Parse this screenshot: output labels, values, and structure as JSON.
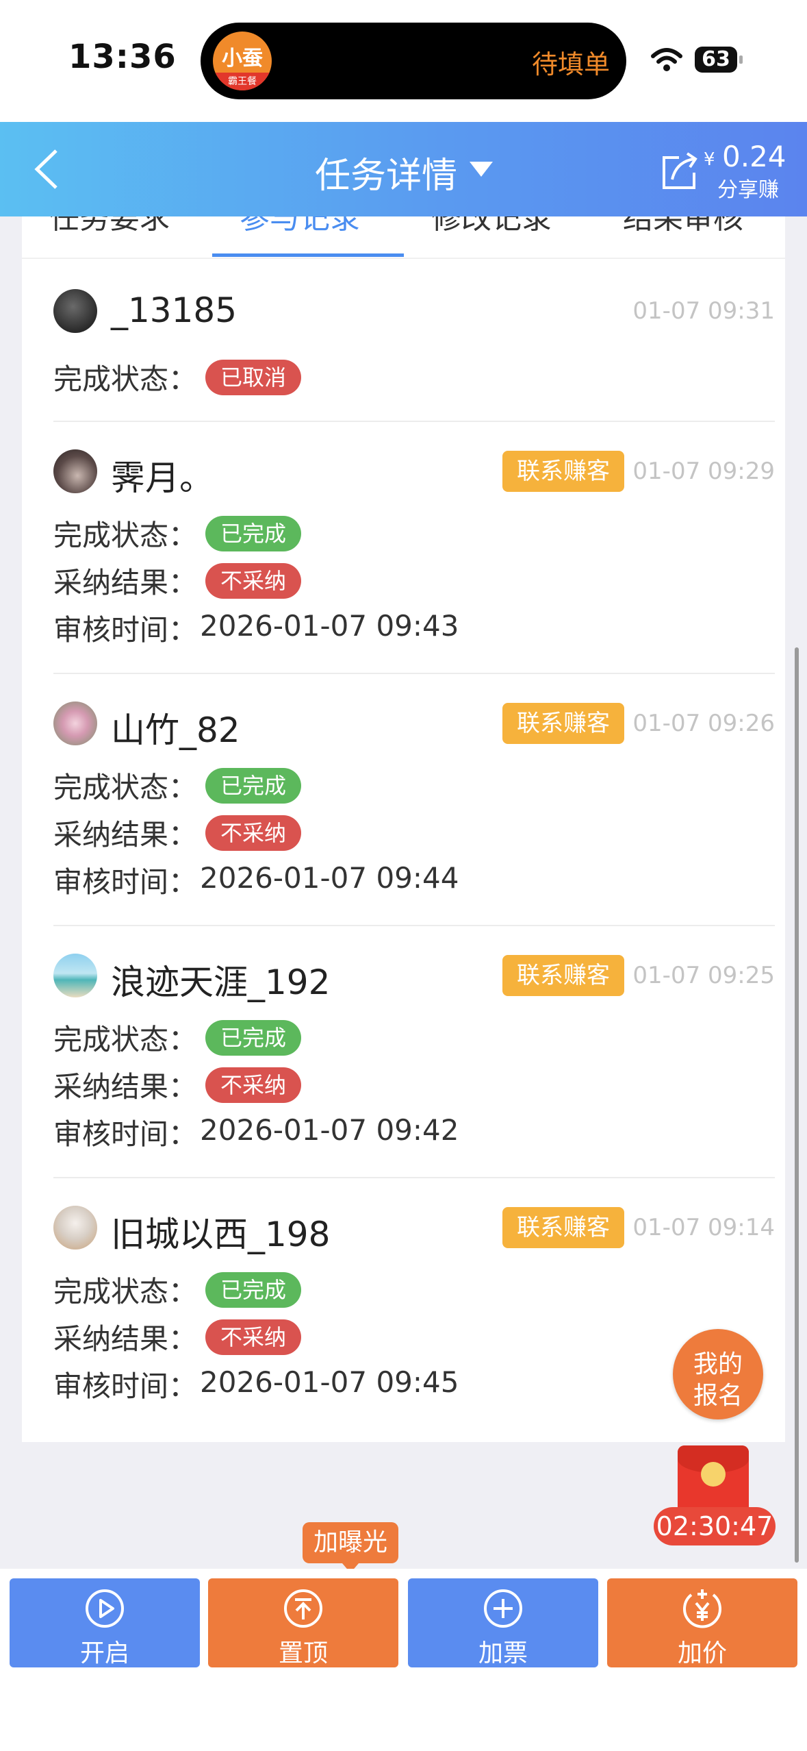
{
  "status_bar": {
    "time": "13:36",
    "island_text": "待填单",
    "app_logo_text": "小蚕",
    "app_logo_subtext": "霸王餐",
    "battery": "63"
  },
  "nav": {
    "title": "任务详情",
    "share_currency": "¥",
    "share_amount": "0.24",
    "share_label": "分享赚"
  },
  "tabs": [
    {
      "label": "任务要求",
      "active": false
    },
    {
      "label": "参与记录",
      "active": true
    },
    {
      "label": "修改记录",
      "active": false
    },
    {
      "label": "结果审核",
      "active": false
    }
  ],
  "labels": {
    "status": "完成状态：",
    "adopt": "采纳结果：",
    "review": "审核时间：",
    "contact": "联系赚客"
  },
  "records": [
    {
      "name": "_13185",
      "time": "01-07 09:31",
      "status": "已取消",
      "status_color": "red",
      "show_contact": false
    },
    {
      "name": "霁月。",
      "time": "01-07 09:29",
      "status": "已完成",
      "adopt": "不采纳",
      "review_time": "2026-01-07 09:43",
      "show_contact": true
    },
    {
      "name": "山竹_82",
      "time": "01-07 09:26",
      "status": "已完成",
      "adopt": "不采纳",
      "review_time": "2026-01-07 09:44",
      "show_contact": true
    },
    {
      "name": "浪迹天涯_192",
      "time": "01-07 09:25",
      "status": "已完成",
      "adopt": "不采纳",
      "review_time": "2026-01-07 09:42",
      "show_contact": true
    },
    {
      "name": "旧城以西_198",
      "time": "01-07 09:14",
      "status": "已完成",
      "adopt": "不采纳",
      "review_time": "2026-01-07 09:45",
      "show_contact": true
    }
  ],
  "floating": {
    "my_signup_line1": "我的",
    "my_signup_line2": "报名",
    "countdown": "02:30:47",
    "boost_tip": "加曝光"
  },
  "bottom_actions": [
    {
      "label": "开启",
      "icon": "play-icon"
    },
    {
      "label": "置顶",
      "icon": "pin-top-icon"
    },
    {
      "label": "加票",
      "icon": "plus-icon"
    },
    {
      "label": "加价",
      "icon": "yen-plus-icon"
    }
  ],
  "colors": {
    "accent_blue": "#4a8df0",
    "orange": "#ee7b3c",
    "contact_yellow": "#f6b23c",
    "green": "#5cb85c",
    "red": "#d9534f"
  }
}
